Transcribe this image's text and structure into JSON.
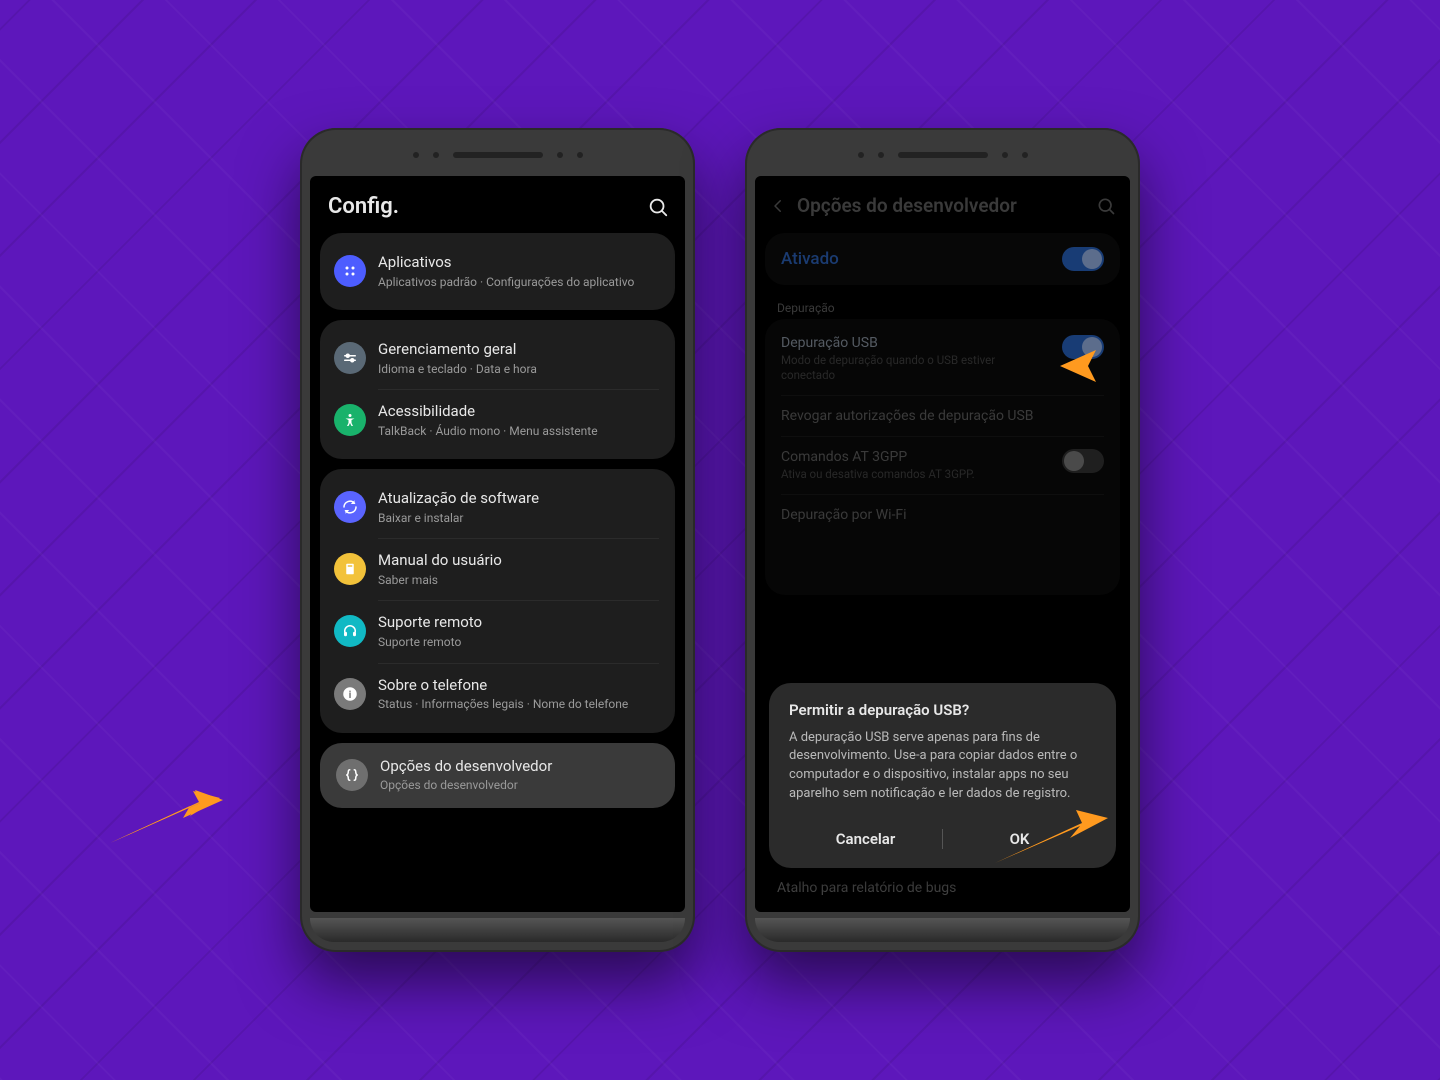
{
  "left": {
    "header_title": "Config.",
    "groups": [
      {
        "rows": [
          {
            "key": "apps",
            "title": "Aplicativos",
            "sub": "Aplicativos padrão · Configurações do aplicativo"
          }
        ]
      },
      {
        "rows": [
          {
            "key": "general",
            "title": "Gerenciamento geral",
            "sub": "Idioma e teclado · Data e hora"
          },
          {
            "key": "access",
            "title": "Acessibilidade",
            "sub": "TalkBack · Áudio mono · Menu assistente"
          }
        ]
      },
      {
        "rows": [
          {
            "key": "update",
            "title": "Atualização de software",
            "sub": "Baixar e instalar"
          },
          {
            "key": "manual",
            "title": "Manual do usuário",
            "sub": "Saber mais"
          },
          {
            "key": "support",
            "title": "Suporte remoto",
            "sub": "Suporte remoto"
          },
          {
            "key": "about",
            "title": "Sobre o telefone",
            "sub": "Status · Informações legais · Nome do telefone"
          }
        ]
      }
    ],
    "highlight": {
      "title": "Opções do desenvolvedor",
      "sub": "Opções do desenvolvedor"
    }
  },
  "right": {
    "header_title": "Opções do desenvolvedor",
    "enabled_label": "Ativado",
    "section_label": "Depuração",
    "rows": {
      "usb": {
        "title": "Depuração USB",
        "sub": "Modo de depuração quando o USB estiver conectado"
      },
      "revoke": {
        "title": "Revogar autorizações de depuração USB"
      },
      "at": {
        "title": "Comandos AT 3GPP",
        "sub": "Ativa ou desativa comandos AT 3GPP."
      },
      "wifi": {
        "title": "Depuração por Wi-Fi"
      }
    },
    "peek": "Atalho para relatório de bugs",
    "dialog": {
      "title": "Permitir a depuração USB?",
      "body": "A depuração USB serve apenas para fins de desenvolvimento. Use-a para copiar dados entre o computador e o dispositivo, instalar apps no seu aparelho sem notificação e ler dados de registro.",
      "cancel": "Cancelar",
      "ok": "OK"
    }
  }
}
